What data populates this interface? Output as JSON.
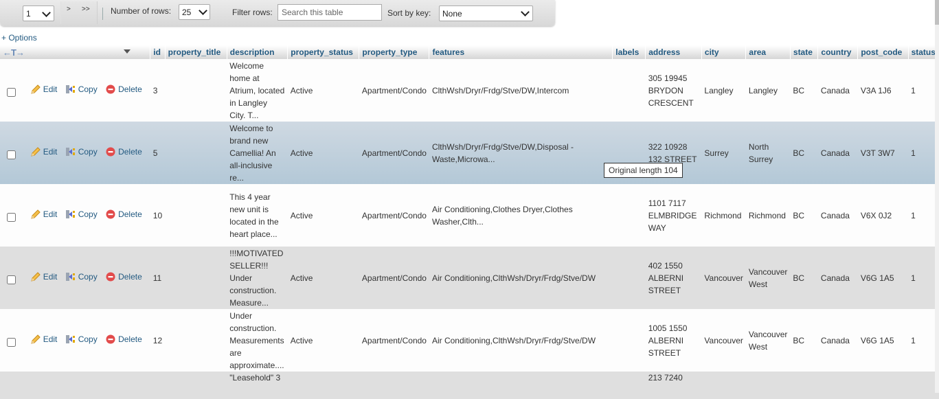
{
  "navbar": {
    "page_select_value": "1",
    "next_label": ">",
    "last_label": ">>",
    "rows_label": "Number of rows:",
    "rows_value": "25",
    "filter_label": "Filter rows:",
    "filter_placeholder": "Search this table",
    "sort_label": "Sort by key:",
    "sort_value": "None"
  },
  "options_link": "+ Options",
  "header": {
    "arrows": "←T→",
    "columns": [
      "id",
      "property_title",
      "description",
      "property_status",
      "property_type",
      "features",
      "labels",
      "address",
      "city",
      "area",
      "state",
      "country",
      "post_code",
      "status"
    ]
  },
  "actions": {
    "edit": "Edit",
    "copy": "Copy",
    "delete": "Delete"
  },
  "rows": [
    {
      "id": "3",
      "property_title": "",
      "description": "Welcome home at Atrium, located in Langley City. T...",
      "property_status": "Active",
      "property_type": "Apartment/Condo",
      "features": "ClthWsh/Dryr/Frdg/Stve/DW,Intercom",
      "labels": "",
      "address": "305 19945 BRYDON CRESCENT",
      "city": "Langley",
      "area": "Langley",
      "state": "BC",
      "country": "Canada",
      "post_code": "V3A 1J6",
      "status": "1"
    },
    {
      "id": "5",
      "property_title": "",
      "description": "Welcome to brand new Camellia! An all-inclusive re...",
      "property_status": "Active",
      "property_type": "Apartment/Condo",
      "features": "ClthWsh/Dryr/Frdg/Stve/DW,Disposal - Waste,Microwa...",
      "labels": "",
      "address": "322 10928 132 STREET",
      "city": "Surrey",
      "area": "North Surrey",
      "state": "BC",
      "country": "Canada",
      "post_code": "V3T 3W7",
      "status": "1"
    },
    {
      "id": "10",
      "property_title": "",
      "description": "This 4 year new unit is located in the heart place...",
      "property_status": "Active",
      "property_type": "Apartment/Condo",
      "features": "Air Conditioning,Clothes Dryer,Clothes Washer,Clth...",
      "labels": "",
      "address": "1101 7117 ELMBRIDGE WAY",
      "city": "Richmond",
      "area": "Richmond",
      "state": "BC",
      "country": "Canada",
      "post_code": "V6X 0J2",
      "status": "1"
    },
    {
      "id": "11",
      "property_title": "",
      "description": "!!!MOTIVATED SELLER!!! Under construction. Measure...",
      "property_status": "Active",
      "property_type": "Apartment/Condo",
      "features": "Air Conditioning,ClthWsh/Dryr/Frdg/Stve/DW",
      "labels": "",
      "address": "402 1550 ALBERNI STREET",
      "city": "Vancouver",
      "area": "Vancouver West",
      "state": "BC",
      "country": "Canada",
      "post_code": "V6G 1A5",
      "status": "1"
    },
    {
      "id": "12",
      "property_title": "",
      "description": "Under construction.  Measurements are approximate....",
      "property_status": "Active",
      "property_type": "Apartment/Condo",
      "features": "Air Conditioning,ClthWsh/Dryr/Frdg/Stve/DW",
      "labels": "",
      "address": "1005 1550 ALBERNI STREET",
      "city": "Vancouver",
      "area": "Vancouver West",
      "state": "BC",
      "country": "Canada",
      "post_code": "V6G 1A5",
      "status": "1"
    },
    {
      "id": "",
      "property_title": "",
      "description": "\"Leasehold\" 3",
      "property_status": "",
      "property_type": "",
      "features": "",
      "labels": "",
      "address": "213 7240",
      "city": "",
      "area": "",
      "state": "",
      "country": "",
      "post_code": "",
      "status": ""
    }
  ],
  "tooltip": "Original length 104",
  "colors": {
    "link": "#235a81",
    "hover_row": "#b3c8d7",
    "even_row": "#dfdfdf"
  }
}
